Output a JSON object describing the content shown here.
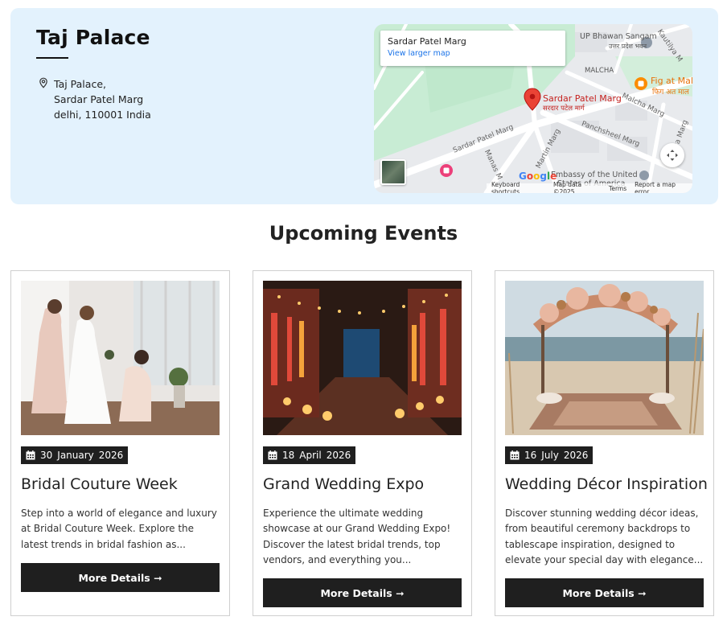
{
  "venue": {
    "name": "Taj Palace",
    "address_lines": [
      "Taj Palace,",
      "Sardar Patel Marg",
      "delhi, 110001 India"
    ]
  },
  "map": {
    "place_title": "Sardar Patel Marg",
    "larger_map_link": "View larger map",
    "labels": {
      "pin_en": "Sardar Patel Marg",
      "pin_hi": "सरदार पटेल मार्ग",
      "bhawan": "UP Bhawan Sangam",
      "bhawan_hi": "उत्तर प्रदेश भवन",
      "malcha": "MALCHA",
      "malcha_marg": "Malcha Marg",
      "fig": "Fig at Mal",
      "fig_hi": "फिग अत माल",
      "panchsheel": "Panchsheel Marg",
      "martin": "Martin Marg",
      "manas": "Manas M",
      "spm_road": "Sardar Patel Marg",
      "kautilya": "Kautilya M",
      "nyaya": "Nyaya Marg",
      "embassy": "Embassy of the United",
      "embassy2": "States of America"
    },
    "footer": {
      "shortcuts": "Keyboard shortcuts",
      "data": "Map data ©2025",
      "terms": "Terms",
      "report": "Report a map error"
    },
    "colors": {
      "green": "#c3ecd0",
      "pin": "#ea4335",
      "road": "#ffffff"
    }
  },
  "events_heading": "Upcoming Events",
  "events": [
    {
      "day": "30",
      "month": "January",
      "year": "2026",
      "title": "Bridal Couture Week",
      "description": "Step into a world of elegance and luxury at Bridal Couture Week. Explore the latest trends in bridal fashion as...",
      "button": "More Details ➞"
    },
    {
      "day": "18",
      "month": "April",
      "year": "2026",
      "title": "Grand Wedding Expo",
      "description": "Experience the ultimate wedding showcase at our Grand Wedding Expo! Discover the latest bridal trends, top vendors, and everything you...",
      "button": "More Details ➞"
    },
    {
      "day": "16",
      "month": "July",
      "year": "2026",
      "title": "Wedding Décor Inspiration",
      "description": "Discover stunning wedding décor ideas, from beautiful ceremony backdrops to tablescape inspiration, designed to elevate your special day with elegance...",
      "button": "More Details ➞"
    }
  ],
  "icons": {
    "location": "map-pin-icon",
    "calendar": "calendar-icon",
    "arrow": "arrow-right-icon"
  }
}
